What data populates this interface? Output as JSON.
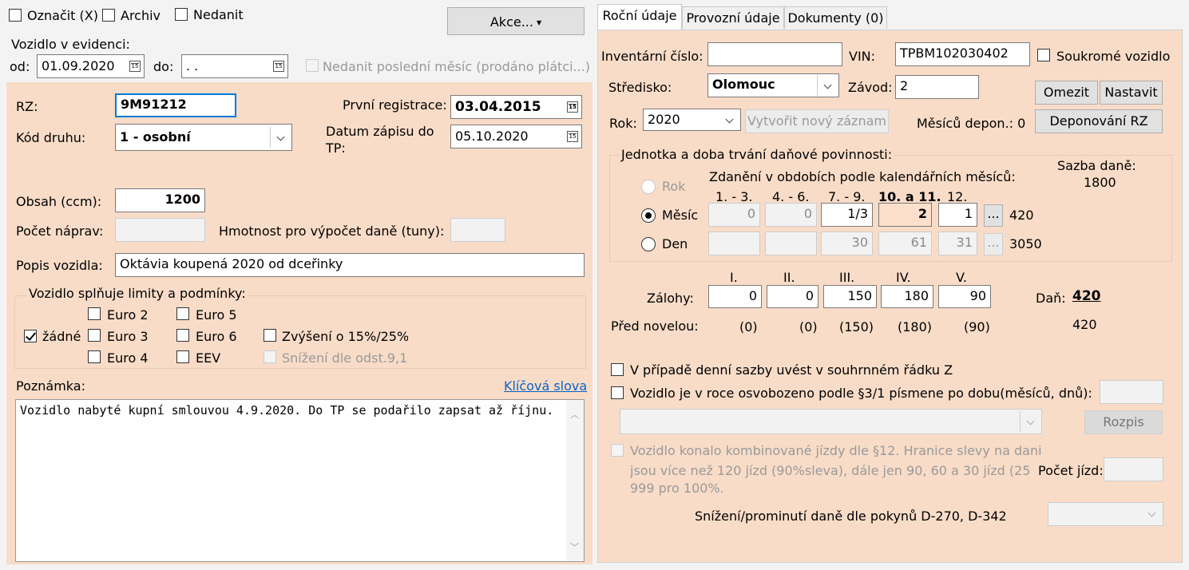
{
  "top": {
    "oznacit": "Označit (X)",
    "archiv": "Archiv",
    "nedanit": "Nedanit",
    "akce": "Akce...",
    "evidence_label": "Vozidlo v evidenci:",
    "od_label": "od:",
    "od_value": "01.09.2020",
    "do_label": "do:",
    "do_value": " .  .",
    "nedanit_posledni": "Nedanit poslední měsíc (prodáno plátci...)"
  },
  "left": {
    "rz_label": "RZ:",
    "rz_value": "9M91212",
    "prvni_reg_label": "První registrace:",
    "prvni_reg_value": "03.04.2015",
    "kod_druhu_label": "Kód druhu:",
    "kod_druhu_value": "1 - osobní",
    "datum_zapisu_label_1": "Datum zápisu do",
    "datum_zapisu_label_2": "TP:",
    "datum_zapisu_value": "05.10.2020",
    "obsah_label": "Obsah (ccm):",
    "obsah_value": "1200",
    "naprav_label": "Počet náprav:",
    "hmotnost_label": "Hmotnost pro výpočet daně (tuny):",
    "popis_label": "Popis vozidla:",
    "popis_value": "Oktávia koupená 2020 od dceřinky",
    "limity_title": "Vozidlo splňuje limity a podmínky:",
    "zadne": "žádné",
    "euro2": "Euro 2",
    "euro3": "Euro 3",
    "euro4": "Euro 4",
    "euro5": "Euro 5",
    "euro6": "Euro 6",
    "eev": "EEV",
    "zvyseni": "Zvýšení o 15%/25%",
    "snizeni": "Snížení dle odst.9,1",
    "poznamka_label": "Poznámka:",
    "klicova_slova": "Klíčová slova",
    "poznamka_text": "Vozidlo nabyté kupní smlouvou 4.9.2020. Do TP se podařilo zapsat až říjnu."
  },
  "tabs": {
    "rocni": "Roční údaje",
    "provozni": "Provozní údaje",
    "dokumenty": "Dokumenty (0)"
  },
  "right": {
    "inventarni_label": "Inventární číslo:",
    "vin_label": "VIN:",
    "vin_value": "TPBM102030402",
    "soukrome": "Soukromé vozidlo",
    "stredisko_label": "Středisko:",
    "stredisko_value": "Olomouc",
    "zavod_label": "Závod:",
    "zavod_value": "2",
    "omezit": "Omezit",
    "nastavit": "Nastavit",
    "rok_label": "Rok:",
    "rok_value": "2020",
    "vytvorit": "Vytvořit nový záznam",
    "mesicu_depon": "Měsíců depon.: 0",
    "deponovani": "Deponování RZ",
    "jednotka_title": "Jednotka a doba trvání daňové povinnosti:",
    "zdaneni_title": "Zdanění v obdobích podle kalendářních měsíců:",
    "sazba_label": "Sazba daně:",
    "sazba_value": "1800",
    "rok_radio": "Rok",
    "mesic_radio": "Měsíc",
    "den_radio": "Den",
    "period_headers": [
      "1. - 3.",
      "4. - 6.",
      "7. - 9.",
      "10. a 11.",
      "12."
    ],
    "mesic_values": [
      "0",
      "0",
      "1/3",
      "2",
      "1"
    ],
    "mesic_total": "420",
    "den_values": [
      "",
      "",
      "30",
      "61",
      "31"
    ],
    "den_total": "3050",
    "ellipsis": "...",
    "zalohy_headers": [
      "I.",
      "II.",
      "III.",
      "IV.",
      "V."
    ],
    "zalohy_label": "Zálohy:",
    "zalohy_values": [
      "0",
      "0",
      "150",
      "180",
      "90"
    ],
    "dan_label": "Daň:",
    "dan_value": "420",
    "pred_label": "Před novelou:",
    "pred_values": [
      "(0)",
      "(0)",
      "(150)",
      "(180)",
      "(90)"
    ],
    "pred_total": "420",
    "denni_sazba": "V případě denní sazby uvést v souhrnném řádku Z",
    "osvobozeno": "Vozidlo je v roce osvobozeno podle §3/1 písmene",
    "po_dobu": "po dobu(měsíců, dnů):",
    "rozpis": "Rozpis",
    "kombinovane_1": "Vozidlo konalo kombinované jízdy dle §12. Hranice slevy na dani",
    "kombinovane_2": "jsou více než 120 jízd (90%sleva), dále jen 90, 60 a 30 jízd (25",
    "kombinovane_3": "999 pro 100%.",
    "pocet_jizd": "Počet jízd:",
    "snizeni_pokyny": "Snížení/prominutí daně dle pokynů D-270, D-342"
  }
}
